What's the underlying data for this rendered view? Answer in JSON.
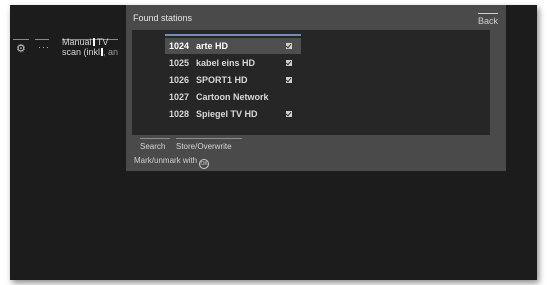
{
  "sidebar": {
    "item_icons": [
      "gear-icon",
      "ellipsis-icon"
    ],
    "manual_text_1": "Manual",
    "manual_text_2": "TV",
    "manual_text_3": "scan (inkl",
    "manual_text_4": ", an"
  },
  "dialog": {
    "title": "Found stations",
    "back_label": "Back",
    "stations": [
      {
        "number": "1024",
        "name": "arte HD",
        "checked": true,
        "selected": true
      },
      {
        "number": "1025",
        "name": "kabel eins HD",
        "checked": true,
        "selected": false
      },
      {
        "number": "1026",
        "name": "SPORT1 HD",
        "checked": true,
        "selected": false
      },
      {
        "number": "1027",
        "name": "Cartoon Network",
        "checked": false,
        "selected": false
      },
      {
        "number": "1028",
        "name": "Spiegel TV HD",
        "checked": true,
        "selected": false
      }
    ],
    "search_label": "Search",
    "store_label": "Store/Overwrite",
    "hint_text": "Mark/unmark with",
    "ok_icon_text": "OK"
  }
}
